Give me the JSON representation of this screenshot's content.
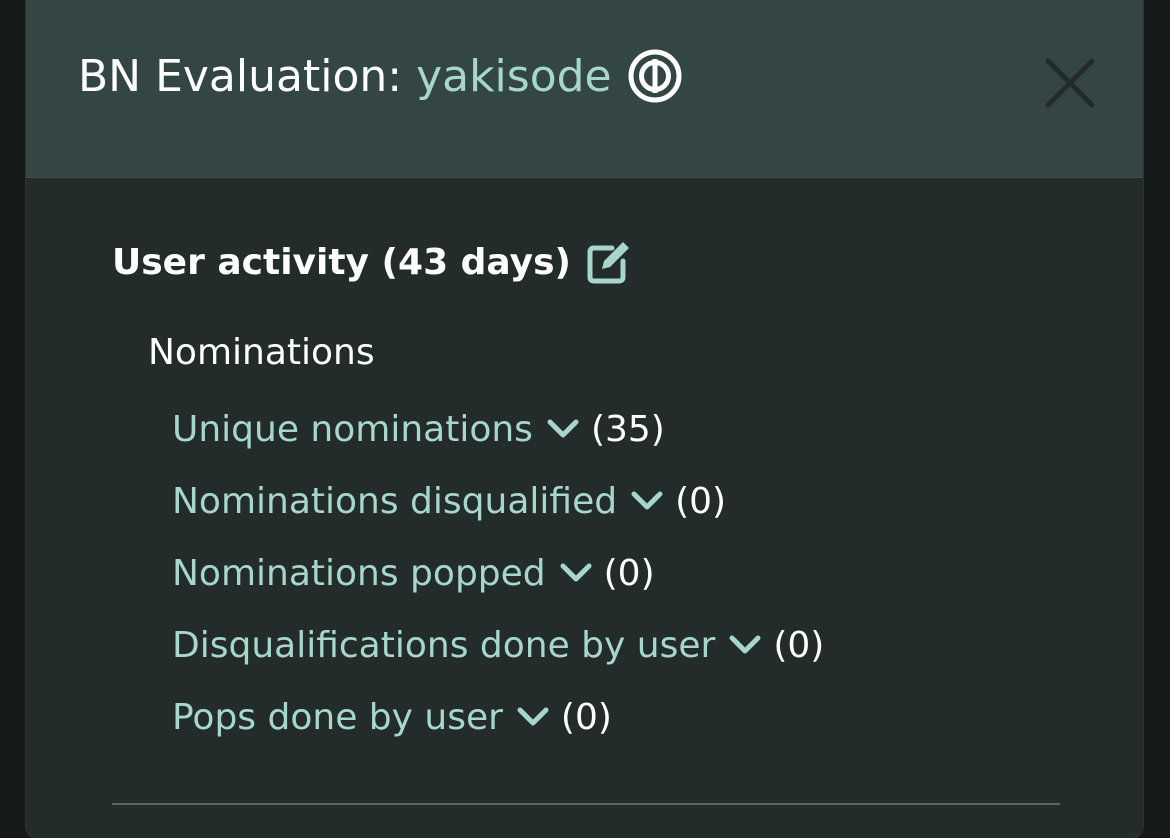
{
  "modal": {
    "title_prefix": "BN Evaluation:",
    "username": "yakisode",
    "mode_icon": "osu-mode-icon",
    "close_icon": "close-icon"
  },
  "activity": {
    "heading": "User activity (43 days)",
    "edit_icon": "edit-icon",
    "group_label": "Nominations",
    "items": [
      {
        "label": "Unique nominations",
        "count": "(35)"
      },
      {
        "label": "Nominations disqualified",
        "count": "(0)"
      },
      {
        "label": "Nominations popped",
        "count": "(0)"
      },
      {
        "label": "Disqualifications done by user",
        "count": "(0)"
      },
      {
        "label": "Pops done by user",
        "count": "(0)"
      }
    ]
  },
  "colors": {
    "accent": "#a7d6cd",
    "header_bg": "#344644",
    "body_bg": "#232c2a"
  }
}
